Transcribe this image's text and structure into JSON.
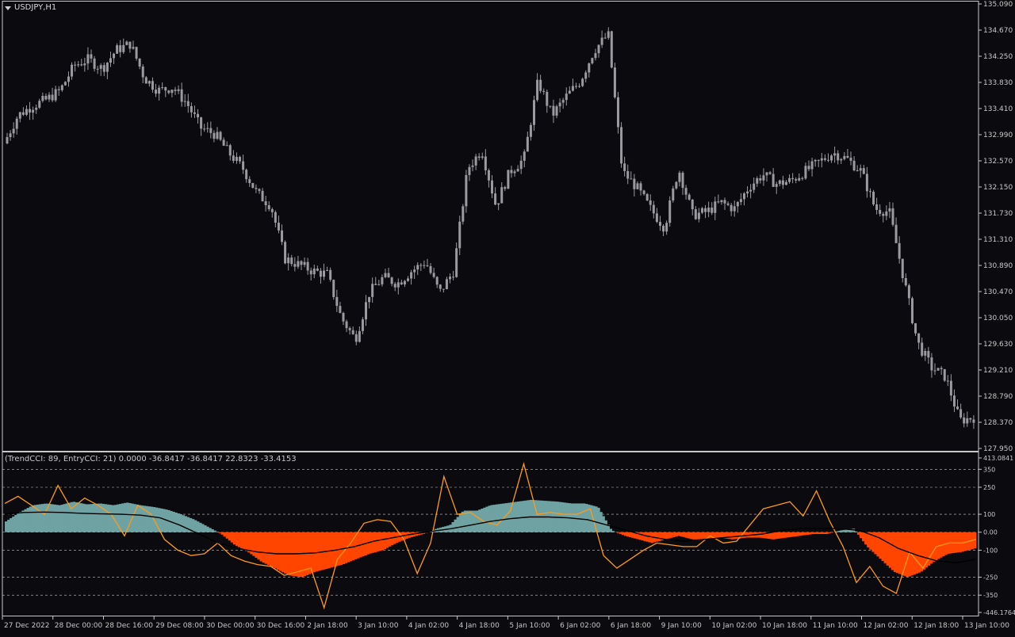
{
  "header": {
    "symbol": "USDJPY,H1"
  },
  "indicator": {
    "label": "(TrendCCI: 89, EntryCCI: 21)  0.0000 -36.8417 -36.8417 22.8323 -33.4153"
  },
  "colors": {
    "background": "#0b0b0f",
    "candle": "#9a9aa0",
    "axis": "#c8c8c8",
    "trend_pos": "#6fa3a3",
    "trend_neg": "#ff4500",
    "entry": "#ff9a1a",
    "ma": "#000000"
  },
  "chart_data": [
    {
      "type": "candlestick",
      "symbol": "USDJPY,H1",
      "ylim": [
        127.95,
        135.09
      ],
      "y_ticks": [
        "135.090",
        "134.670",
        "134.250",
        "133.830",
        "133.410",
        "132.990",
        "132.570",
        "132.150",
        "131.730",
        "131.310",
        "130.890",
        "130.470",
        "130.050",
        "129.630",
        "129.210",
        "128.790",
        "128.370",
        "127.950"
      ],
      "x_ticks": [
        "27 Dec 2022",
        "28 Dec 00:00",
        "28 Dec 16:00",
        "29 Dec 08:00",
        "30 Dec 00:00",
        "30 Dec 16:00",
        "2 Jan 18:00",
        "3 Jan 10:00",
        "4 Jan 02:00",
        "4 Jan 18:00",
        "5 Jan 10:00",
        "6 Jan 02:00",
        "6 Jan 18:00",
        "9 Jan 10:00",
        "10 Jan 02:00",
        "10 Jan 18:00",
        "11 Jan 10:00",
        "12 Jan 02:00",
        "12 Jan 18:00",
        "13 Jan 10:00"
      ],
      "close_path": [
        132.85,
        133.3,
        133.45,
        133.55,
        133.7,
        134.1,
        134.2,
        134.05,
        134.35,
        134.45,
        133.9,
        133.7,
        133.75,
        133.5,
        133.1,
        133.0,
        132.7,
        132.45,
        132.05,
        131.85,
        131.0,
        130.9,
        130.8,
        130.75,
        130.05,
        129.7,
        130.45,
        130.7,
        130.6,
        130.8,
        130.95,
        130.45,
        130.8,
        132.45,
        132.75,
        131.85,
        132.4,
        132.6,
        133.85,
        133.3,
        133.6,
        133.85,
        134.35,
        134.6,
        132.4,
        132.15,
        131.8,
        131.5,
        132.45,
        131.7,
        131.75,
        131.9,
        131.8,
        132.15,
        132.35,
        132.2,
        132.25,
        132.4,
        132.55,
        132.7,
        132.6,
        132.4,
        131.8,
        131.75,
        130.7,
        129.65,
        129.25,
        129.1,
        128.4,
        128.45
      ]
    },
    {
      "type": "indicator",
      "name": "TrendCCI/EntryCCI",
      "ylim": [
        -446.1764,
        413.0841
      ],
      "y_ticks": [
        "413.0841",
        "350",
        "250",
        "100",
        "0.00",
        "-100",
        "-250",
        "-350",
        "-446.1764"
      ],
      "levels": [
        350,
        250,
        100,
        0,
        -100,
        -250,
        -350
      ],
      "trend_cci": [
        60,
        110,
        150,
        160,
        150,
        170,
        155,
        160,
        150,
        165,
        150,
        140,
        125,
        100,
        70,
        30,
        -10,
        -70,
        -110,
        -165,
        -200,
        -240,
        -250,
        -220,
        -200,
        -180,
        -150,
        -120,
        -100,
        -60,
        -30,
        -10,
        20,
        40,
        120,
        120,
        150,
        160,
        170,
        180,
        175,
        170,
        160,
        160,
        140,
        10,
        -20,
        -40,
        -60,
        -40,
        -20,
        -40,
        -40,
        -30,
        -40,
        -30,
        -30,
        -40,
        -30,
        -20,
        -10,
        -10,
        10,
        20,
        -80,
        -150,
        -220,
        -250,
        -220,
        -160,
        -120,
        -110,
        -90
      ],
      "entry_cci": [
        160,
        200,
        150,
        100,
        260,
        130,
        190,
        150,
        100,
        -20,
        150,
        100,
        -40,
        -100,
        -130,
        -120,
        -60,
        -130,
        -160,
        -180,
        -190,
        -240,
        -220,
        -200,
        -420,
        -150,
        -60,
        50,
        70,
        60,
        -40,
        -230,
        -60,
        310,
        100,
        110,
        60,
        40,
        120,
        380,
        100,
        110,
        100,
        100,
        130,
        -130,
        -200,
        -150,
        -100,
        -60,
        -70,
        -80,
        -80,
        -20,
        -60,
        -50,
        40,
        130,
        150,
        170,
        90,
        230,
        60,
        -80,
        -280,
        -190,
        -300,
        -340,
        -110,
        -200,
        -80,
        -60,
        -60,
        -40
      ],
      "ma": [
        100,
        110,
        112,
        110,
        105,
        102,
        100,
        95,
        80,
        40,
        -10,
        -60,
        -90,
        -110,
        -120,
        -120,
        -115,
        -100,
        -80,
        -50,
        -30,
        -10,
        5,
        20,
        40,
        60,
        75,
        85,
        85,
        80,
        70,
        40,
        10,
        -20,
        -40,
        -50,
        -40,
        -30,
        -20,
        -10,
        10,
        20,
        20,
        20,
        10,
        -30,
        -90,
        -130,
        -160,
        -170,
        -150
      ]
    }
  ]
}
